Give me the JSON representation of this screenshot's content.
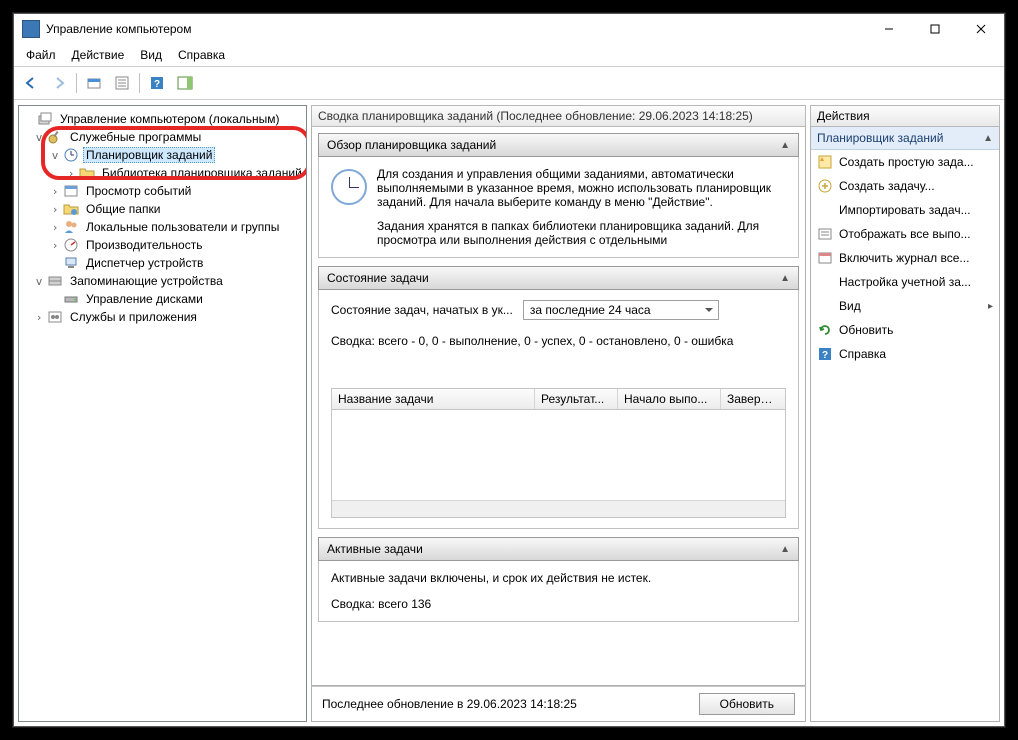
{
  "titlebar": {
    "title": "Управление компьютером"
  },
  "menu": {
    "file": "Файл",
    "action": "Действие",
    "view": "Вид",
    "help": "Справка"
  },
  "tree": {
    "root": "Управление компьютером (локальным)",
    "sys": "Служебные программы",
    "sched": "Планировщик заданий",
    "lib": "Библиотека планировщика заданий",
    "evt": "Просмотр событий",
    "shared": "Общие папки",
    "users": "Локальные пользователи и группы",
    "perf": "Производительность",
    "dev": "Диспетчер устройств",
    "storage": "Запоминающие устройства",
    "disk": "Управление дисками",
    "svc": "Службы и приложения"
  },
  "center": {
    "header": "Сводка планировщика заданий (Последнее обновление: 29.06.2023 14:18:25)",
    "p1": "Обзор планировщика заданий",
    "ov1": "Для создания и управления общими заданиями, автоматически выполняемыми в указанное время, можно использовать планировщик заданий. Для начала выберите команду в меню \"Действие\".",
    "ov2": "Задания хранятся в папках библиотеки планировщика заданий. Для просмотра или выполнения действия с отдельными",
    "p2": "Состояние задачи",
    "state_lbl": "Состояние задач, начатых в ук...",
    "combo": "за последние 24 часа",
    "summary": "Сводка: всего - 0, 0 - выполнение, 0 - успех, 0 - остановлено, 0 - ошибка",
    "cols": {
      "c1": "Название задачи",
      "c2": "Результат...",
      "c3": "Начало выпо...",
      "c4": "Завершени"
    },
    "p3": "Активные задачи",
    "active_text": "Активные задачи включены, и срок их действия не истек.",
    "active_sum": "Сводка: всего 136",
    "foot": "Последнее обновление в 29.06.2023 14:18:25",
    "refresh": "Обновить"
  },
  "actions": {
    "header": "Действия",
    "section": "Планировщик заданий",
    "a1": "Создать простую зада...",
    "a2": "Создать задачу...",
    "a3": "Импортировать задач...",
    "a4": "Отображать все выпо...",
    "a5": "Включить журнал все...",
    "a6": "Настройка учетной за...",
    "a7": "Вид",
    "a8": "Обновить",
    "a9": "Справка"
  }
}
